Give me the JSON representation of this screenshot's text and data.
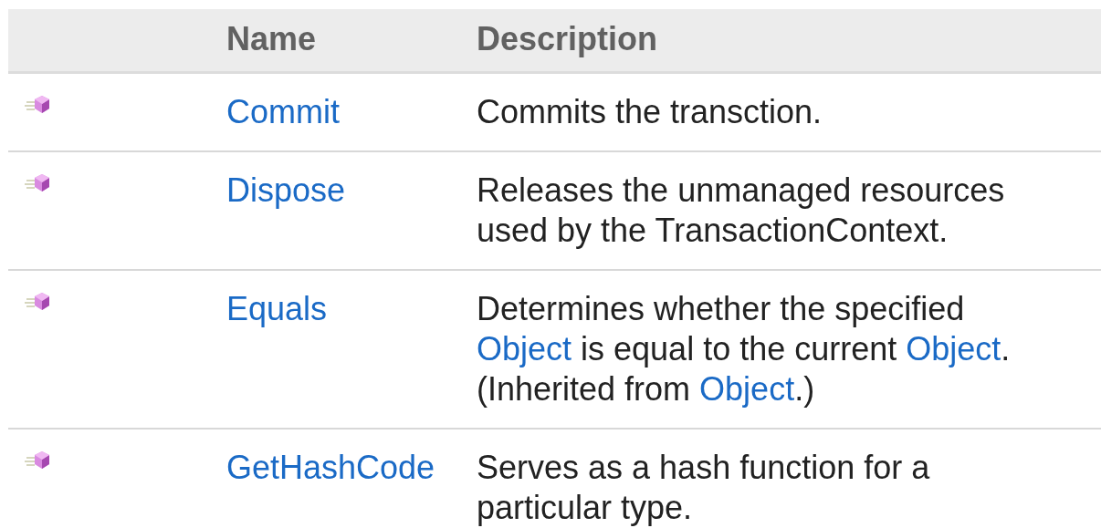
{
  "table": {
    "columns": [
      {},
      {
        "label": "Name"
      },
      {
        "label": "Description"
      }
    ],
    "rows": [
      {
        "name": "Commit",
        "description": [
          {
            "kind": "text",
            "text": "Commits the transction."
          }
        ]
      },
      {
        "name": "Dispose",
        "description": [
          {
            "kind": "text",
            "text": "Releases the unmanaged resources used by the TransactionContext."
          }
        ]
      },
      {
        "name": "Equals",
        "description": [
          {
            "kind": "text",
            "text": "Determines whether the specified "
          },
          {
            "kind": "link",
            "text": "Object"
          },
          {
            "kind": "text",
            "text": " is equal to the current "
          },
          {
            "kind": "link",
            "text": "Object"
          },
          {
            "kind": "text",
            "text": ". (Inherited from "
          },
          {
            "kind": "link",
            "text": "Object"
          },
          {
            "kind": "text",
            "text": ".)"
          }
        ]
      },
      {
        "name": "GetHashCode",
        "description": [
          {
            "kind": "text",
            "text": "Serves as a hash function for a particular type."
          }
        ]
      }
    ]
  }
}
